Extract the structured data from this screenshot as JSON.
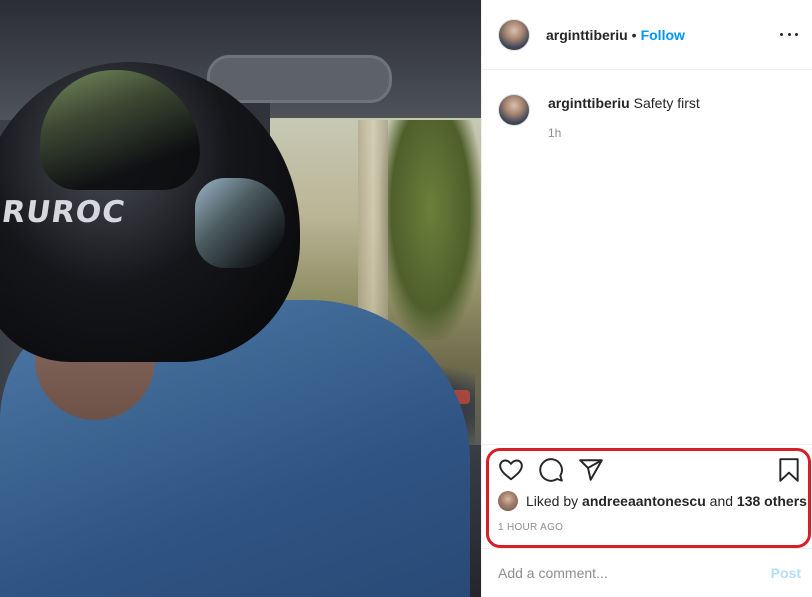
{
  "photo": {
    "helmet_brand": "RUROC"
  },
  "header": {
    "username": "arginttiberiu",
    "separator": "•",
    "follow_label": "Follow"
  },
  "caption": {
    "username": "arginttiberiu",
    "text": "Safety first",
    "time": "1h"
  },
  "actions": {
    "like_icon": "heart-icon",
    "comment_icon": "comment-icon",
    "share_icon": "paper-plane-icon",
    "save_icon": "bookmark-icon"
  },
  "likes": {
    "prefix": "Liked by",
    "user": "andreeaantonescu",
    "middle": "and",
    "others": "138 others"
  },
  "post_time": "1 HOUR AGO",
  "comment": {
    "placeholder": "Add a comment...",
    "post_label": "Post"
  },
  "colors": {
    "follow": "#0095f6",
    "highlight": "#d71f27",
    "post_disabled": "#b2dffc"
  }
}
